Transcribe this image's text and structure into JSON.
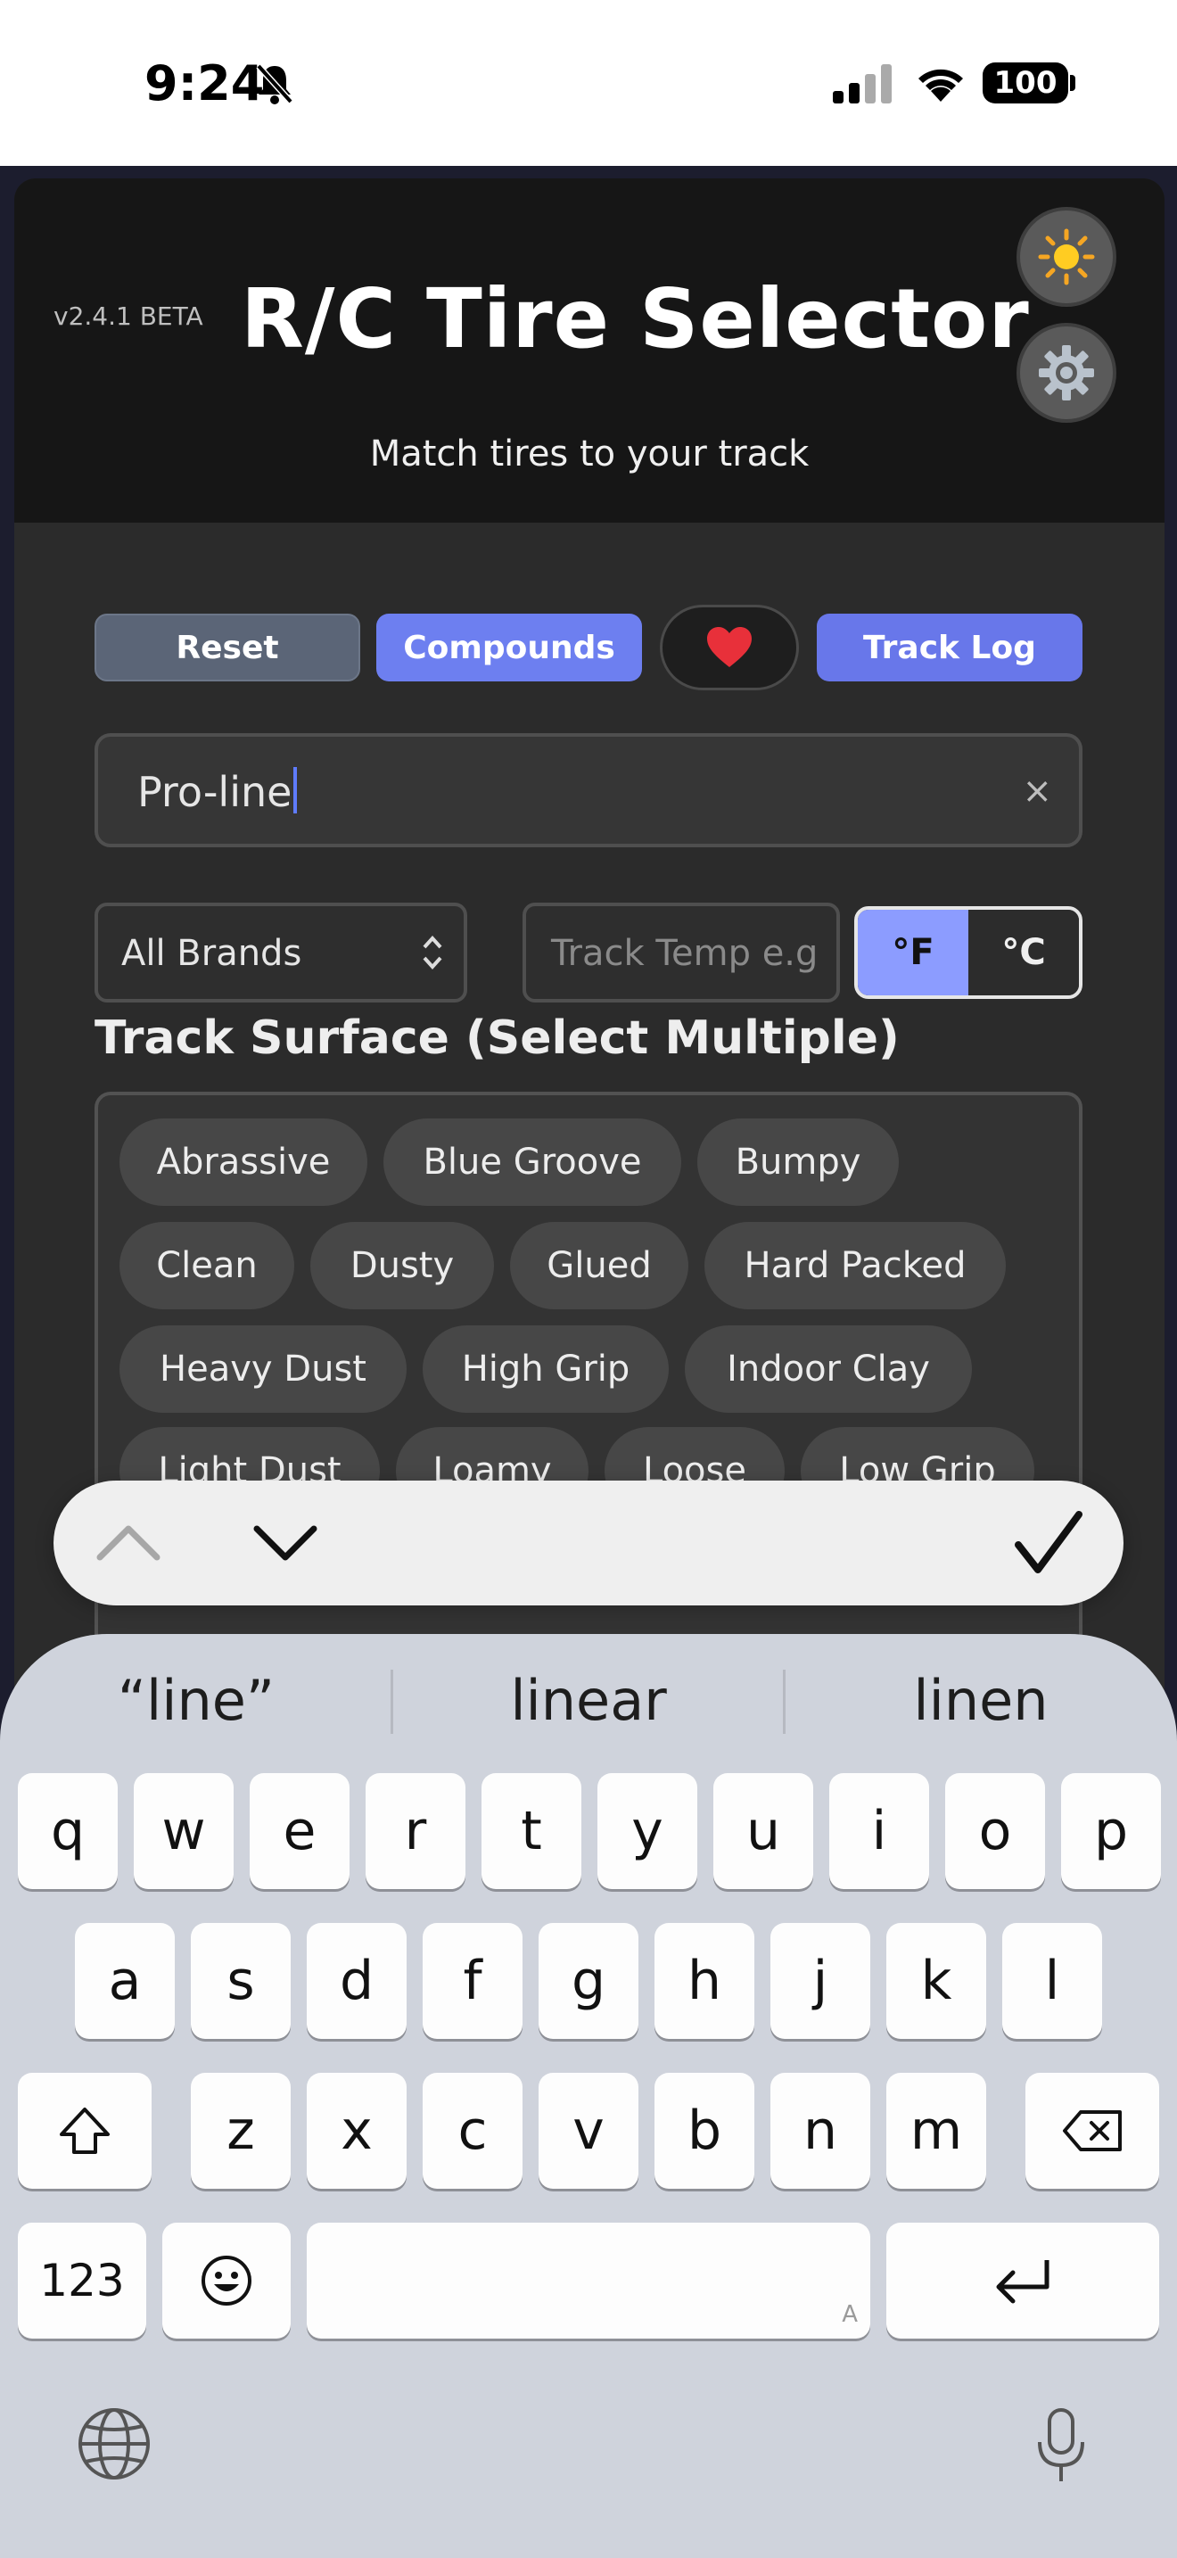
{
  "status_bar": {
    "time": "9:24",
    "battery": "100"
  },
  "header": {
    "version": "v2.4.1 BETA",
    "title": "R/C Tire Selector",
    "subtitle": "Match tires to your track",
    "theme_icon": "sun-icon",
    "settings_icon": "gear-icon"
  },
  "toolbar": {
    "reset_label": "Reset",
    "compounds_label": "Compounds",
    "favorites_icon": "heart-icon",
    "track_log_label": "Track Log"
  },
  "search": {
    "value": "Pro-line",
    "clear_label": "×"
  },
  "filters": {
    "brand_selected": "All Brands",
    "temp_placeholder": "Track Temp e.g",
    "unit_f": "°F",
    "unit_c": "°C",
    "selected_unit": "°F"
  },
  "surface": {
    "title": "Track Surface (Select Multiple)",
    "chips": [
      "Abrassive",
      "Blue Groove",
      "Bumpy",
      "Clean",
      "Dusty",
      "Glued",
      "Hard Packed",
      "Heavy Dust",
      "High Grip",
      "Indoor Clay",
      "Light Dust",
      "Loamy",
      "Loose",
      "Low Grip"
    ]
  },
  "keyboard": {
    "suggestions": [
      "“line”",
      "linear",
      "linen"
    ],
    "row1": [
      "q",
      "w",
      "e",
      "r",
      "t",
      "y",
      "u",
      "i",
      "o",
      "p"
    ],
    "row2": [
      "a",
      "s",
      "d",
      "f",
      "g",
      "h",
      "j",
      "k",
      "l"
    ],
    "row3": [
      "z",
      "x",
      "c",
      "v",
      "b",
      "n",
      "m"
    ],
    "numbers_label": "123",
    "space_hint": "A"
  },
  "colors": {
    "accent": "#6d7ff0",
    "unit_active": "#8c9cff",
    "header_bg": "#161616"
  }
}
